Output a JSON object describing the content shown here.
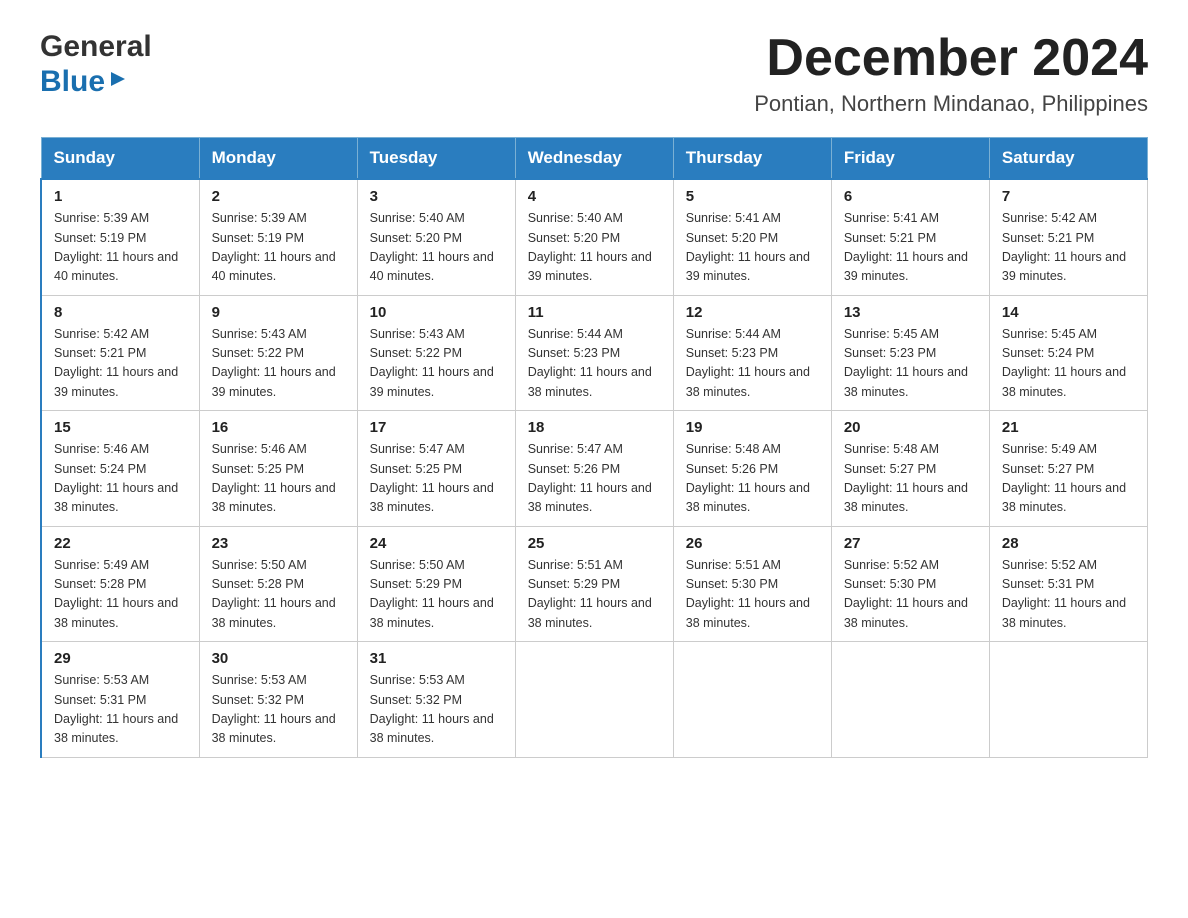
{
  "header": {
    "logo_general": "General",
    "logo_blue": "Blue",
    "title": "December 2024",
    "location": "Pontian, Northern Mindanao, Philippines"
  },
  "days_of_week": [
    "Sunday",
    "Monday",
    "Tuesday",
    "Wednesday",
    "Thursday",
    "Friday",
    "Saturday"
  ],
  "weeks": [
    [
      {
        "day": "1",
        "sunrise": "5:39 AM",
        "sunset": "5:19 PM",
        "daylight": "11 hours and 40 minutes."
      },
      {
        "day": "2",
        "sunrise": "5:39 AM",
        "sunset": "5:19 PM",
        "daylight": "11 hours and 40 minutes."
      },
      {
        "day": "3",
        "sunrise": "5:40 AM",
        "sunset": "5:20 PM",
        "daylight": "11 hours and 40 minutes."
      },
      {
        "day": "4",
        "sunrise": "5:40 AM",
        "sunset": "5:20 PM",
        "daylight": "11 hours and 39 minutes."
      },
      {
        "day": "5",
        "sunrise": "5:41 AM",
        "sunset": "5:20 PM",
        "daylight": "11 hours and 39 minutes."
      },
      {
        "day": "6",
        "sunrise": "5:41 AM",
        "sunset": "5:21 PM",
        "daylight": "11 hours and 39 minutes."
      },
      {
        "day": "7",
        "sunrise": "5:42 AM",
        "sunset": "5:21 PM",
        "daylight": "11 hours and 39 minutes."
      }
    ],
    [
      {
        "day": "8",
        "sunrise": "5:42 AM",
        "sunset": "5:21 PM",
        "daylight": "11 hours and 39 minutes."
      },
      {
        "day": "9",
        "sunrise": "5:43 AM",
        "sunset": "5:22 PM",
        "daylight": "11 hours and 39 minutes."
      },
      {
        "day": "10",
        "sunrise": "5:43 AM",
        "sunset": "5:22 PM",
        "daylight": "11 hours and 39 minutes."
      },
      {
        "day": "11",
        "sunrise": "5:44 AM",
        "sunset": "5:23 PM",
        "daylight": "11 hours and 38 minutes."
      },
      {
        "day": "12",
        "sunrise": "5:44 AM",
        "sunset": "5:23 PM",
        "daylight": "11 hours and 38 minutes."
      },
      {
        "day": "13",
        "sunrise": "5:45 AM",
        "sunset": "5:23 PM",
        "daylight": "11 hours and 38 minutes."
      },
      {
        "day": "14",
        "sunrise": "5:45 AM",
        "sunset": "5:24 PM",
        "daylight": "11 hours and 38 minutes."
      }
    ],
    [
      {
        "day": "15",
        "sunrise": "5:46 AM",
        "sunset": "5:24 PM",
        "daylight": "11 hours and 38 minutes."
      },
      {
        "day": "16",
        "sunrise": "5:46 AM",
        "sunset": "5:25 PM",
        "daylight": "11 hours and 38 minutes."
      },
      {
        "day": "17",
        "sunrise": "5:47 AM",
        "sunset": "5:25 PM",
        "daylight": "11 hours and 38 minutes."
      },
      {
        "day": "18",
        "sunrise": "5:47 AM",
        "sunset": "5:26 PM",
        "daylight": "11 hours and 38 minutes."
      },
      {
        "day": "19",
        "sunrise": "5:48 AM",
        "sunset": "5:26 PM",
        "daylight": "11 hours and 38 minutes."
      },
      {
        "day": "20",
        "sunrise": "5:48 AM",
        "sunset": "5:27 PM",
        "daylight": "11 hours and 38 minutes."
      },
      {
        "day": "21",
        "sunrise": "5:49 AM",
        "sunset": "5:27 PM",
        "daylight": "11 hours and 38 minutes."
      }
    ],
    [
      {
        "day": "22",
        "sunrise": "5:49 AM",
        "sunset": "5:28 PM",
        "daylight": "11 hours and 38 minutes."
      },
      {
        "day": "23",
        "sunrise": "5:50 AM",
        "sunset": "5:28 PM",
        "daylight": "11 hours and 38 minutes."
      },
      {
        "day": "24",
        "sunrise": "5:50 AM",
        "sunset": "5:29 PM",
        "daylight": "11 hours and 38 minutes."
      },
      {
        "day": "25",
        "sunrise": "5:51 AM",
        "sunset": "5:29 PM",
        "daylight": "11 hours and 38 minutes."
      },
      {
        "day": "26",
        "sunrise": "5:51 AM",
        "sunset": "5:30 PM",
        "daylight": "11 hours and 38 minutes."
      },
      {
        "day": "27",
        "sunrise": "5:52 AM",
        "sunset": "5:30 PM",
        "daylight": "11 hours and 38 minutes."
      },
      {
        "day": "28",
        "sunrise": "5:52 AM",
        "sunset": "5:31 PM",
        "daylight": "11 hours and 38 minutes."
      }
    ],
    [
      {
        "day": "29",
        "sunrise": "5:53 AM",
        "sunset": "5:31 PM",
        "daylight": "11 hours and 38 minutes."
      },
      {
        "day": "30",
        "sunrise": "5:53 AM",
        "sunset": "5:32 PM",
        "daylight": "11 hours and 38 minutes."
      },
      {
        "day": "31",
        "sunrise": "5:53 AM",
        "sunset": "5:32 PM",
        "daylight": "11 hours and 38 minutes."
      },
      null,
      null,
      null,
      null
    ]
  ],
  "labels": {
    "sunrise": "Sunrise:",
    "sunset": "Sunset:",
    "daylight": "Daylight:"
  },
  "colors": {
    "header_bg": "#2a7dbf",
    "header_text": "#ffffff",
    "border": "#aaaaaa",
    "accent_blue": "#1a6faf"
  }
}
